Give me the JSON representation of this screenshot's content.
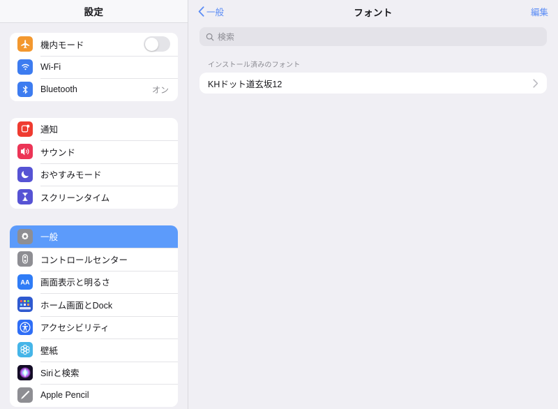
{
  "sidebar": {
    "title": "設定",
    "groups": [
      {
        "name": "connectivity",
        "items": [
          {
            "label": "機内モード",
            "icon": "airplane-icon",
            "accessory": "toggle",
            "toggle_on": false,
            "selected": false
          },
          {
            "label": "Wi-Fi",
            "icon": "wifi-icon",
            "accessory": "none",
            "value": "",
            "selected": false
          },
          {
            "label": "Bluetooth",
            "icon": "bluetooth-icon",
            "accessory": "value",
            "value": "オン",
            "selected": false
          }
        ]
      },
      {
        "name": "alerts",
        "items": [
          {
            "label": "通知",
            "icon": "notifications-icon",
            "accessory": "none",
            "value": "",
            "selected": false
          },
          {
            "label": "サウンド",
            "icon": "sounds-icon",
            "accessory": "none",
            "value": "",
            "selected": false
          },
          {
            "label": "おやすみモード",
            "icon": "do-not-disturb-icon",
            "accessory": "none",
            "value": "",
            "selected": false
          },
          {
            "label": "スクリーンタイム",
            "icon": "screen-time-icon",
            "accessory": "none",
            "value": "",
            "selected": false
          }
        ]
      },
      {
        "name": "system",
        "items": [
          {
            "label": "一般",
            "icon": "gear-icon",
            "accessory": "none",
            "value": "",
            "selected": true
          },
          {
            "label": "コントロールセンター",
            "icon": "control-center-icon",
            "accessory": "none",
            "value": "",
            "selected": false
          },
          {
            "label": "画面表示と明るさ",
            "icon": "display-brightness-icon",
            "accessory": "none",
            "value": "",
            "selected": false
          },
          {
            "label": "ホーム画面とDock",
            "icon": "home-screen-dock-icon",
            "accessory": "none",
            "value": "",
            "selected": false
          },
          {
            "label": "アクセシビリティ",
            "icon": "accessibility-icon",
            "accessory": "none",
            "value": "",
            "selected": false
          },
          {
            "label": "壁紙",
            "icon": "wallpaper-icon",
            "accessory": "none",
            "value": "",
            "selected": false
          },
          {
            "label": "Siriと検索",
            "icon": "siri-search-icon",
            "accessory": "none",
            "value": "",
            "selected": false
          },
          {
            "label": "Apple Pencil",
            "icon": "apple-pencil-icon",
            "accessory": "none",
            "value": "",
            "selected": false
          }
        ]
      }
    ]
  },
  "detail": {
    "back_label": "一般",
    "title": "フォント",
    "edit_label": "編集",
    "search": {
      "placeholder": "検索",
      "value": "",
      "icon": "search-icon"
    },
    "section_header": "インストール済みのフォント",
    "fonts": [
      {
        "label": "KHドット道玄坂12",
        "accessory": "chevron-right-icon"
      }
    ]
  },
  "colors": {
    "selection_blue": "#5c9bfb",
    "tint_blue": "#5b8cf5",
    "page_background": "#f0eff4",
    "card_background": "#ffffff",
    "secondary_text": "#8b8b92"
  }
}
